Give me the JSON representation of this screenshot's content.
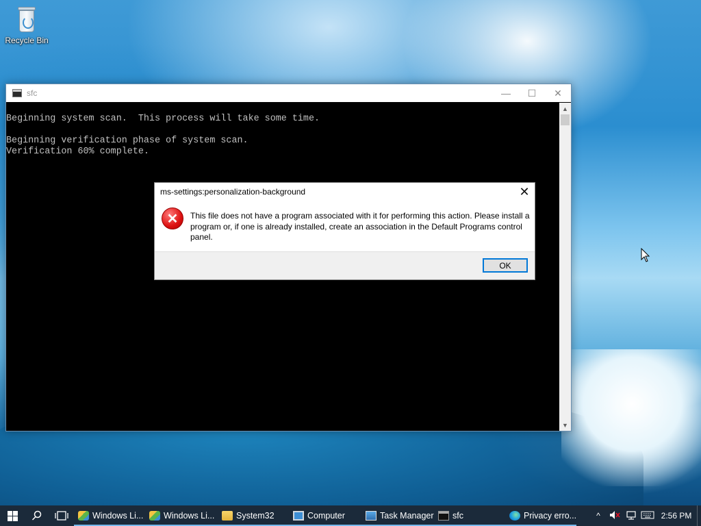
{
  "desktop": {
    "icons": [
      {
        "label": "Recycle Bin",
        "icon": "recycle-bin-icon"
      }
    ]
  },
  "console_window": {
    "title": "sfc",
    "controls": {
      "minimize": "—",
      "maximize": "☐",
      "close": "✕"
    },
    "lines": [
      "Beginning system scan.  This process will take some time.",
      "",
      "Beginning verification phase of system scan.",
      "Verification 60% complete."
    ]
  },
  "dialog": {
    "title": "ms-settings:personalization-background",
    "message": "This file does not have a program associated with it for performing this action. Please install a program or, if one is already installed, create an association in the Default Programs control panel.",
    "ok_label": "OK",
    "icon": "error-icon"
  },
  "taskbar": {
    "items": [
      {
        "label": "Windows Li...",
        "icon": "windows-live-icon"
      },
      {
        "label": "Windows Li...",
        "icon": "windows-live-icon"
      },
      {
        "label": "System32",
        "icon": "folder-icon"
      },
      {
        "label": "Computer",
        "icon": "computer-icon"
      },
      {
        "label": "Task Manager",
        "icon": "task-manager-icon"
      },
      {
        "label": "sfc",
        "icon": "console-icon"
      },
      {
        "label": "Privacy erro...",
        "icon": "edge-icon"
      }
    ],
    "tray": {
      "chevron": "^",
      "clock": "2:56 PM"
    }
  },
  "colors": {
    "taskbar": "#1b2a3a",
    "console_bg": "#000000",
    "console_text": "#c0c0c0",
    "accent": "#0078d7",
    "error": "#d11111"
  }
}
